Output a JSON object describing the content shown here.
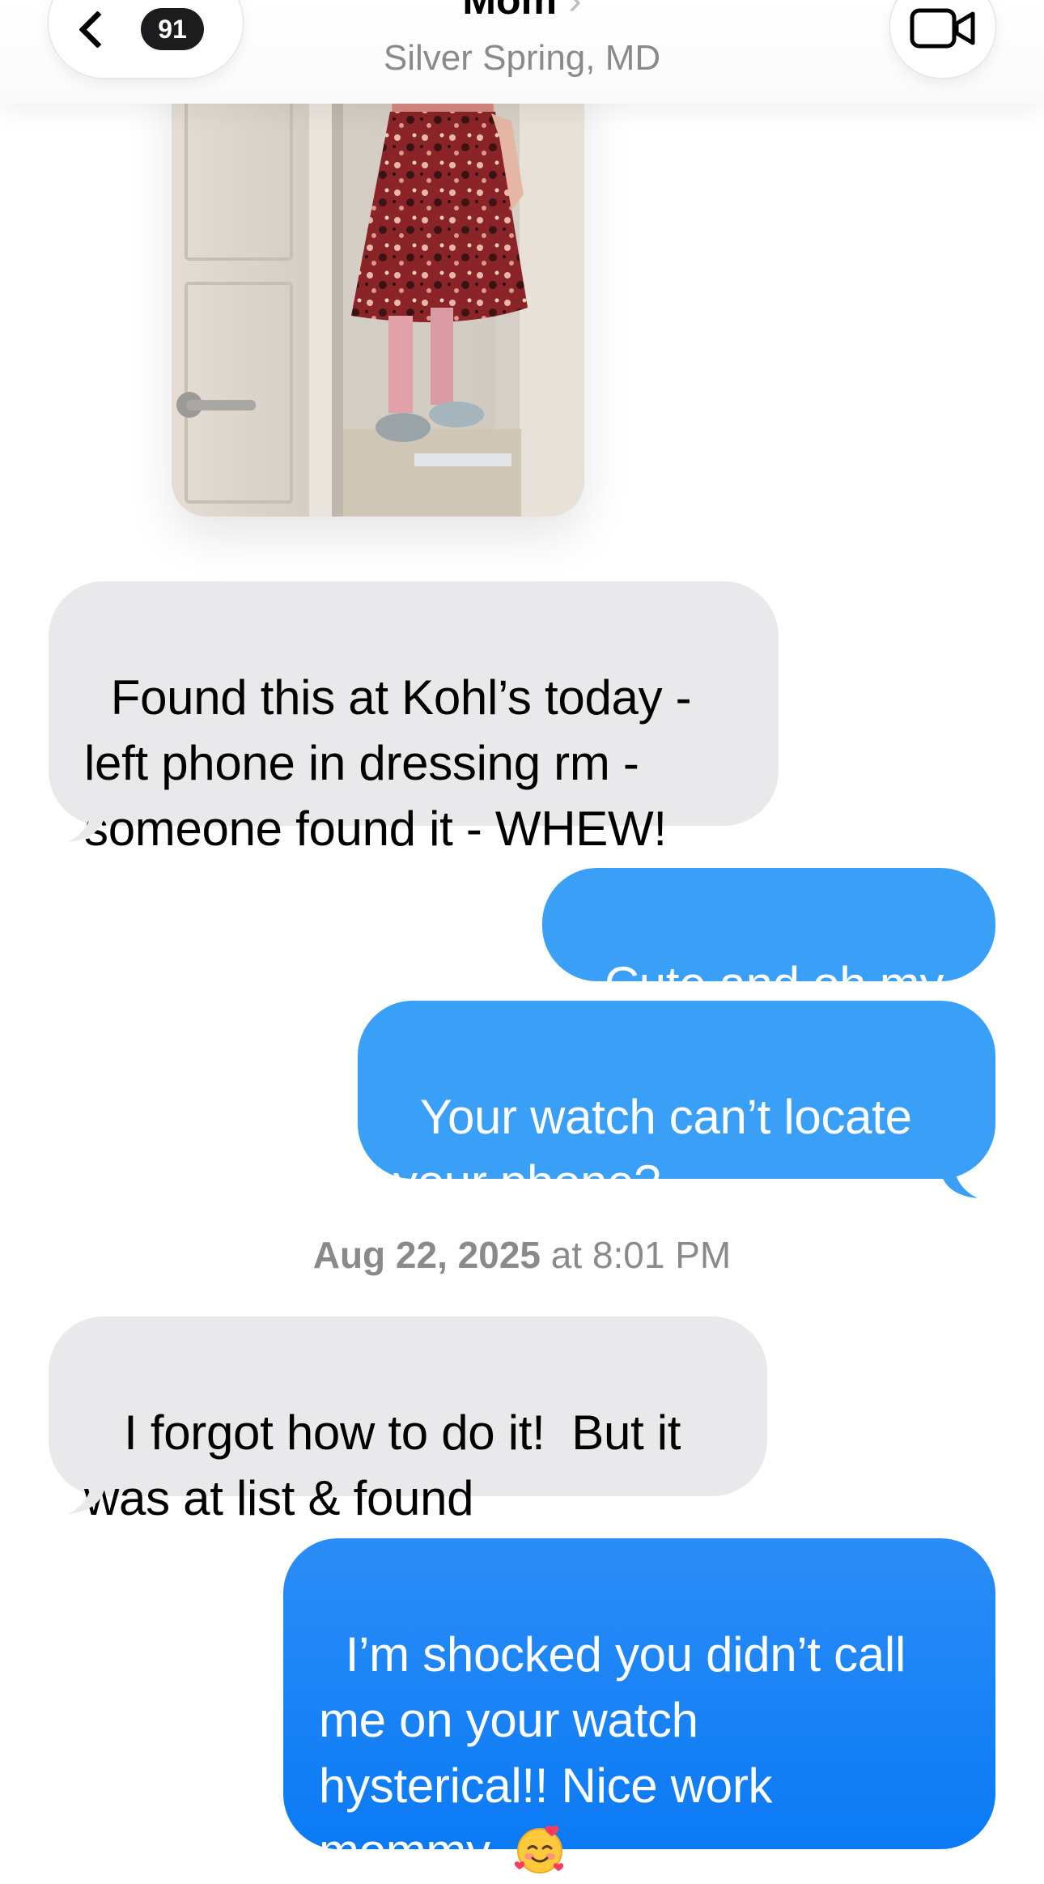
{
  "header": {
    "back_badge_count": "91",
    "contact_name": "Mom",
    "contact_chevron": "›",
    "contact_subtitle": "Silver Spring, MD",
    "icons": {
      "back": "chevron-left-icon",
      "video": "video-camera-icon"
    }
  },
  "messages": [
    {
      "direction": "incoming",
      "text": "Found this at Kohl’s today -\nleft phone in dressing rm -\nsomeone found it - WHEW!"
    },
    {
      "direction": "outgoing",
      "text": "Cute and oh my"
    },
    {
      "direction": "outgoing",
      "text": "Your watch can’t locate\nyour phone?"
    },
    {
      "direction": "incoming",
      "text": " I forgot how to do it!  But it\nwas at list & found"
    },
    {
      "direction": "outgoing",
      "text": "I’m shocked you didn’t call\nme on your watch\nhysterical!! Nice work\nmommy. ",
      "emoji": "smiling-face-with-hearts"
    }
  ],
  "timestamp": {
    "date": "Aug 22, 2025",
    "connector": " at ",
    "time": "8:01 PM"
  },
  "colors": {
    "incoming_bubble": "#e9e9eb",
    "outgoing_bubble": "#3a9ff6",
    "outgoing_bubble_deep": "#0b7af5",
    "secondary_text": "#8a8a8e"
  }
}
